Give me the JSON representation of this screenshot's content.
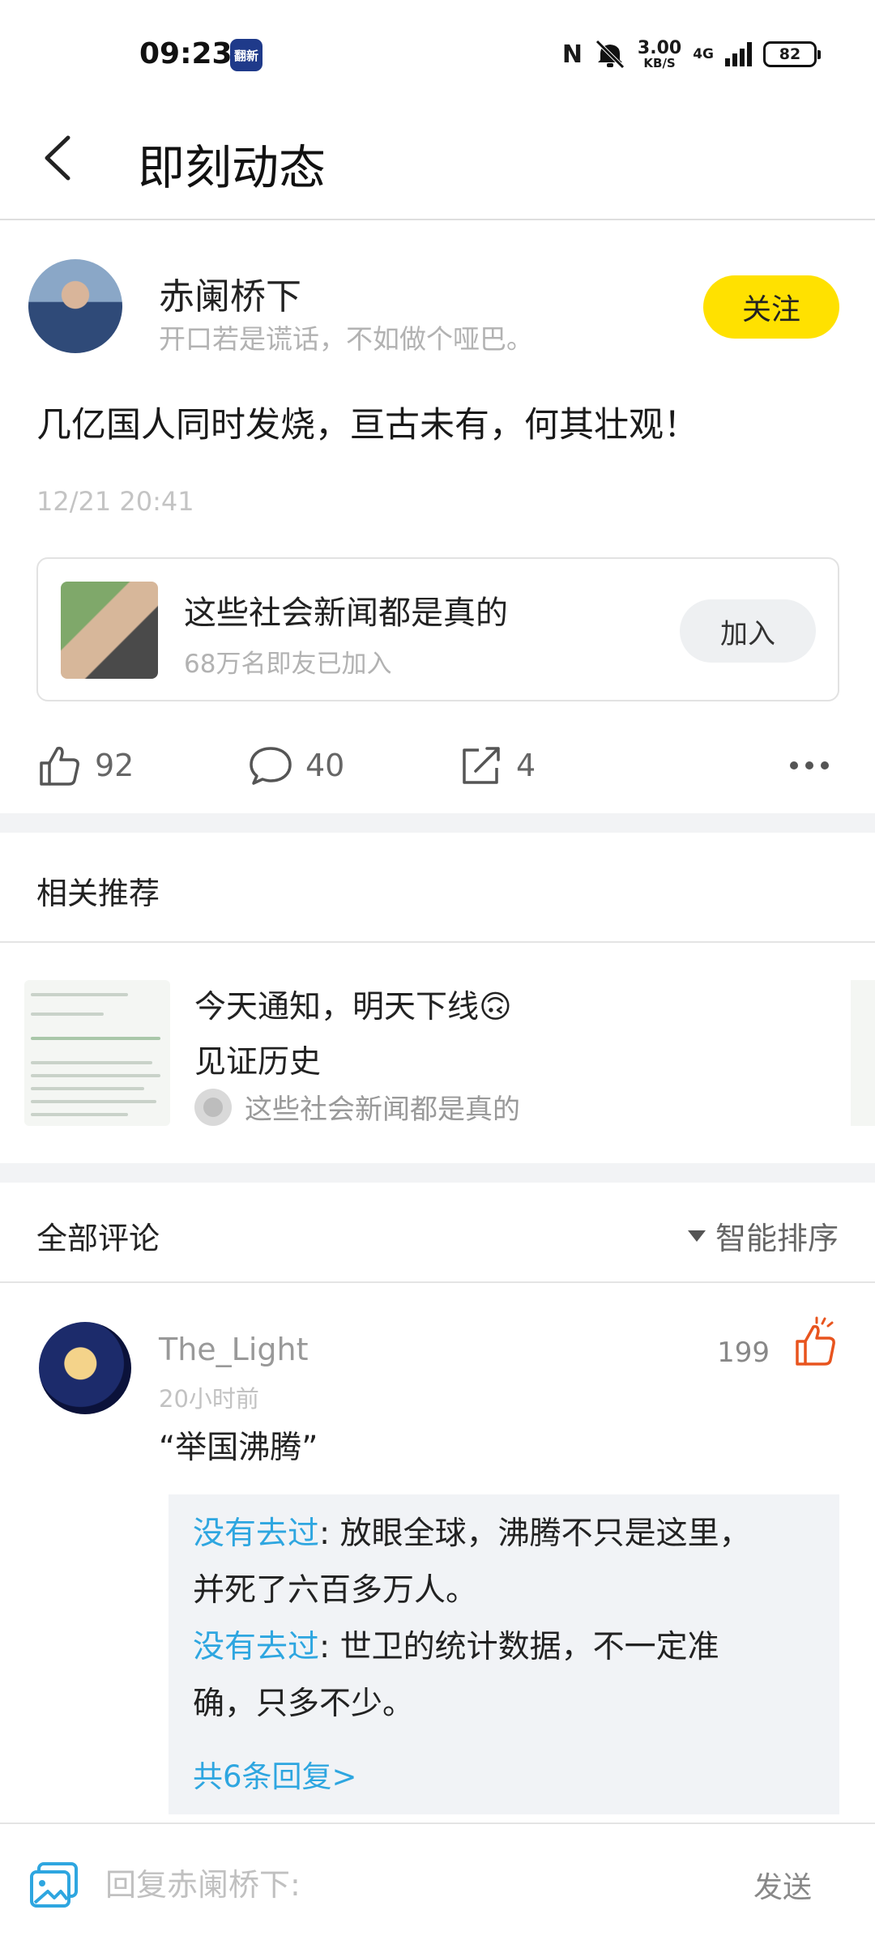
{
  "status_bar": {
    "time": "09:23",
    "app_badge": "翻新",
    "nfc": "N",
    "net_speed": "3.00",
    "net_unit": "KB/S",
    "network": "4G",
    "battery": "82"
  },
  "header": {
    "title": "即刻动态"
  },
  "post": {
    "author": "赤阑桥下",
    "bio": "开口若是谎话，不如做个哑巴。",
    "follow_label": "关注",
    "text": "几亿国人同时发烧，亘古未有，何其壮观！",
    "time": "12/21 20:41",
    "group": {
      "name": "这些社会新闻都是真的",
      "members": "68万名即友已加入",
      "join_label": "加入"
    },
    "actions": {
      "likes": "92",
      "comments": "40",
      "shares": "4"
    }
  },
  "recommend": {
    "title": "相关推荐",
    "item": {
      "line1": "今天通知，明天下线🙃",
      "line2": "见证历史",
      "group": "这些社会新闻都是真的"
    }
  },
  "comments": {
    "title": "全部评论",
    "sort_label": "智能排序",
    "items": [
      {
        "user": "The_Light",
        "time": "20小时前",
        "likes": "199",
        "text": "“举国沸腾”",
        "replies": [
          {
            "user": "没有去过",
            "sep": ": ",
            "text": "放眼全球，沸腾不只是这里，并死了六百多万人。"
          },
          {
            "user": "没有去过",
            "sep": ": ",
            "text": "世卫的统计数据，不一定准确，只多不少。"
          }
        ],
        "more_replies": "共6条回复>"
      }
    ]
  },
  "bottom_bar": {
    "placeholder": "回复赤阑桥下:",
    "send_label": "发送"
  },
  "colors": {
    "follow_bg": "#ffe100",
    "link": "#2ea6e0",
    "like_highlight": "#e8541e"
  }
}
